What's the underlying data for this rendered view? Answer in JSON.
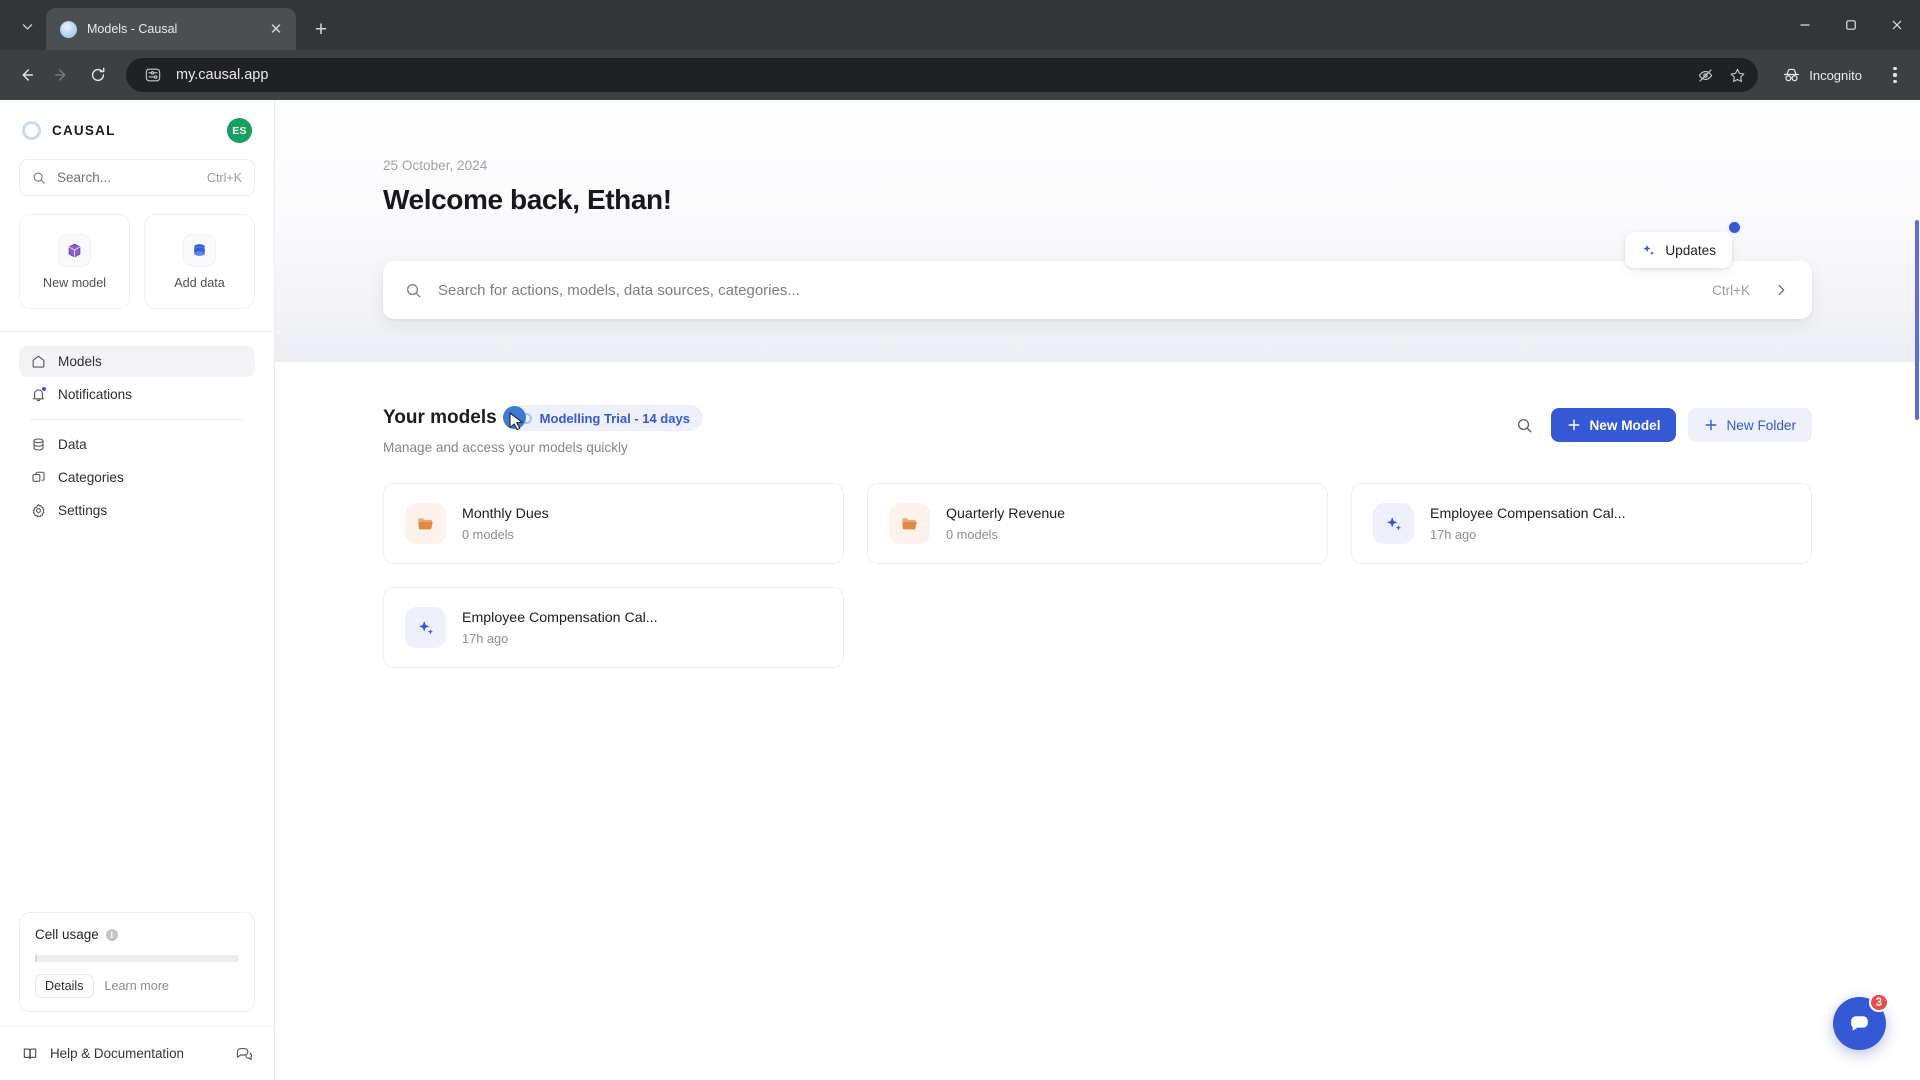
{
  "browser": {
    "tab": {
      "title": "Models - Causal",
      "favicon": "causal-favicon"
    },
    "new_tab_label": "+",
    "close_label": "✕",
    "url": "my.causal.app",
    "incognito_label": "Incognito",
    "nav": {
      "back": "back-arrow",
      "forward": "forward-arrow",
      "reload": "reload-arrow"
    },
    "window": {
      "minimize": "—",
      "maximize": "❐",
      "close": "✕"
    }
  },
  "sidebar": {
    "brand": "CAUSAL",
    "avatar_initials": "ES",
    "search": {
      "placeholder": "Search...",
      "shortcut": "Ctrl+K"
    },
    "quick_actions": [
      {
        "label": "New model",
        "icon": "cube-icon"
      },
      {
        "label": "Add data",
        "icon": "database-icon"
      }
    ],
    "nav_primary": [
      {
        "label": "Models",
        "icon": "home-icon",
        "active": true,
        "dot": false
      },
      {
        "label": "Notifications",
        "icon": "bell-icon",
        "active": false,
        "dot": true
      }
    ],
    "nav_secondary": [
      {
        "label": "Data",
        "icon": "database-icon",
        "active": false
      },
      {
        "label": "Categories",
        "icon": "layers-icon",
        "active": false
      },
      {
        "label": "Settings",
        "icon": "gear-icon",
        "active": false
      }
    ],
    "usage": {
      "title": "Cell usage",
      "info_glyph": "i",
      "progress_percent": 0,
      "details_label": "Details",
      "learn_more_label": "Learn more"
    },
    "footer": {
      "help_label": "Help & Documentation",
      "help_icon": "book-icon",
      "feedback_icon": "chat-icon"
    }
  },
  "main": {
    "date": "25 October, 2024",
    "welcome": "Welcome back, Ethan!",
    "updates": {
      "label": "Updates",
      "icon": "sparkle-icon",
      "has_badge": true
    },
    "search": {
      "placeholder": "Search for actions, models, data sources, categories...",
      "shortcut": "Ctrl+K",
      "go_icon": "chevron-right-icon",
      "search_icon": "search-icon"
    },
    "models_section": {
      "title": "Your models",
      "trial_badge": "Modelling Trial - 14 days",
      "subtitle": "Manage and access your models quickly",
      "search_icon": "search-icon",
      "new_model_label": "New Model",
      "new_folder_label": "New Folder"
    },
    "cards": [
      {
        "title": "Monthly Dues",
        "sub": "0 models",
        "kind": "folder",
        "icon": "folder-icon"
      },
      {
        "title": "Quarterly Revenue",
        "sub": "0 models",
        "kind": "folder",
        "icon": "folder-icon"
      },
      {
        "title": "Employee Compensation Cal...",
        "sub": "17h ago",
        "kind": "model",
        "icon": "sparkle-icon"
      },
      {
        "title": "Employee Compensation Cal...",
        "sub": "17h ago",
        "kind": "model",
        "icon": "sparkle-icon"
      }
    ],
    "chat": {
      "count": "3",
      "icon": "chat-bubble-icon"
    }
  },
  "colors": {
    "accent": "#3558d4",
    "accent_soft": "#eef1fb",
    "avatar_green": "#17a05e",
    "badge_red": "#ea4b4b",
    "folder_orange": "#e08a46"
  }
}
